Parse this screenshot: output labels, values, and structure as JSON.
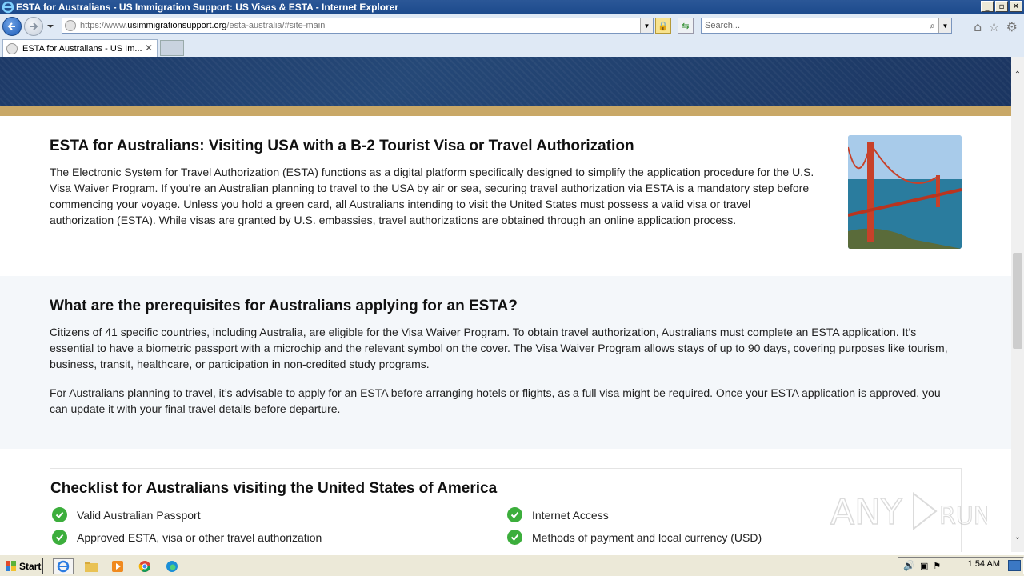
{
  "window": {
    "title": "ESTA for Australians - US Immigration Support: US Visas & ESTA - Internet Explorer",
    "buttons": {
      "minimize": "_",
      "maximize": "▫",
      "close": "✕"
    }
  },
  "navbar": {
    "url_prefix": "https://www.",
    "url_domain": "usimmigrationsupport.org",
    "url_path": "/esta-australia/#site-main",
    "search_placeholder": "Search..."
  },
  "tabs": [
    {
      "label": "ESTA for Australians - US Im..."
    }
  ],
  "section1": {
    "heading": "ESTA for Australians: Visiting USA with a B-2 Tourist Visa or Travel Authorization",
    "paragraph": "The Electronic System for Travel Authorization (ESTA) functions as a digital platform specifically designed to simplify the application procedure for the U.S. Visa Waiver Program. If you’re an Australian planning to travel to the USA by air or sea, securing travel authorization via ESTA is a mandatory step before commencing your voyage. Unless you hold a green card, all Australians intending to visit the United States must possess a valid visa or travel authorization (ESTA). While visas are granted by U.S. embassies, travel authorizations are obtained through an online application process."
  },
  "section2": {
    "heading": "What are the prerequisites for Australians applying for an ESTA?",
    "paragraph1": "Citizens of 41 specific countries, including Australia, are eligible for the Visa Waiver Program. To obtain travel authorization, Australians must complete an ESTA application. It’s essential to have a biometric passport with a microchip and the relevant symbol on the cover. The Visa Waiver Program allows stays of up to 90 days, covering purposes like tourism, business, transit, healthcare, or participation in non-credited study programs.",
    "paragraph2": "For Australians planning to travel, it’s advisable to apply for an ESTA before arranging hotels or flights, as a full visa might be required. Once your ESTA application is approved, you can update it with your final travel details before departure."
  },
  "section3": {
    "heading": "Checklist for Australians visiting the United States of America",
    "left_items": [
      "Valid Australian Passport",
      "Approved ESTA, visa or other travel authorization"
    ],
    "right_items": [
      "Internet Access",
      "Methods of payment and local currency (USD)"
    ]
  },
  "watermark": "ANY RUN",
  "taskbar": {
    "start_label": "Start",
    "clock": "1:54 AM"
  },
  "colors": {
    "hero": "#1d3a68",
    "gold_band": "#c9a867",
    "check_green": "#3cae3c",
    "section_alt_bg": "#f4f7fa"
  }
}
